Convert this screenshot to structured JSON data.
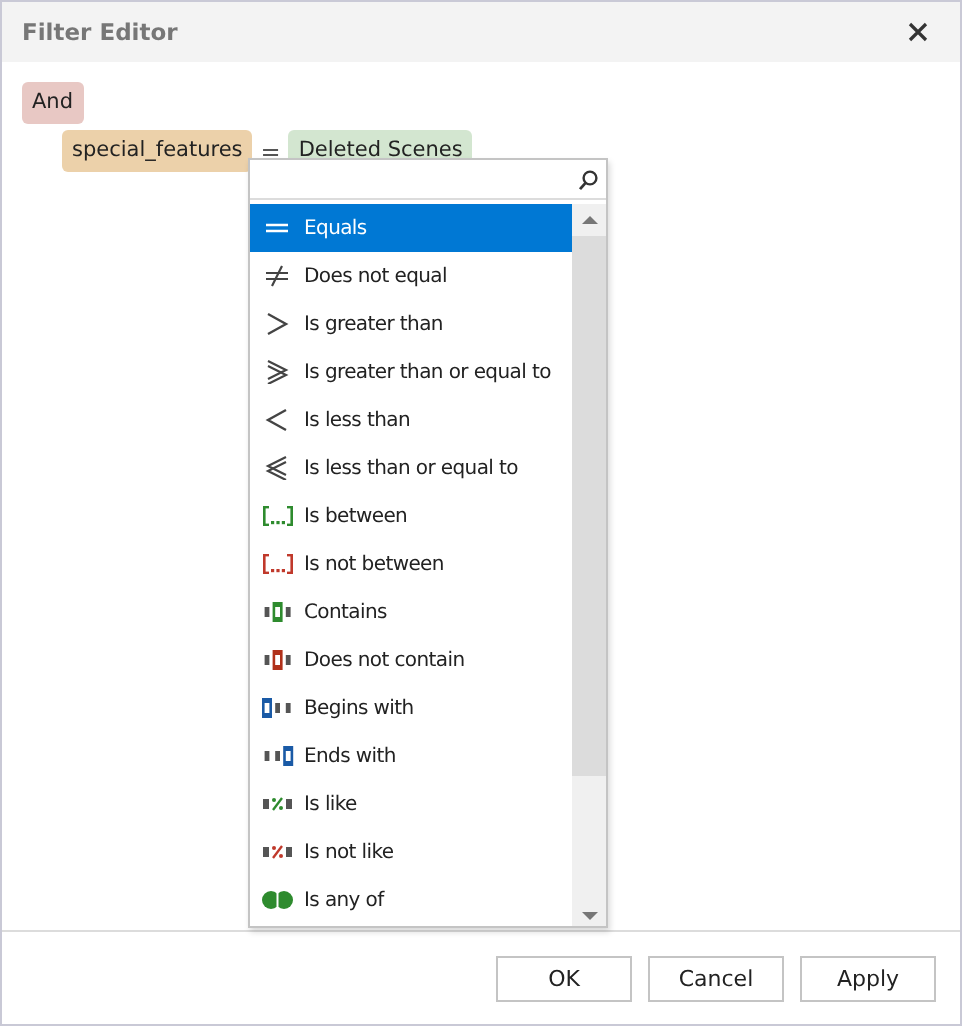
{
  "window": {
    "title": "Filter Editor"
  },
  "filter": {
    "group": "And",
    "condition": {
      "field": "special_features",
      "operator": "=",
      "value": "Deleted Scenes"
    }
  },
  "operator_menu": {
    "items": [
      {
        "label": "Equals",
        "kind": "eq",
        "selected": true
      },
      {
        "label": "Does not equal",
        "kind": "neq",
        "selected": false
      },
      {
        "label": "Is greater than",
        "kind": "gt",
        "selected": false
      },
      {
        "label": "Is greater than or equal to",
        "kind": "gte",
        "selected": false
      },
      {
        "label": "Is less than",
        "kind": "lt",
        "selected": false
      },
      {
        "label": "Is less than or equal to",
        "kind": "lte",
        "selected": false
      },
      {
        "label": "Is between",
        "kind": "between",
        "selected": false
      },
      {
        "label": "Is not between",
        "kind": "notbetween",
        "selected": false
      },
      {
        "label": "Contains",
        "kind": "contains",
        "selected": false
      },
      {
        "label": "Does not contain",
        "kind": "notcontains",
        "selected": false
      },
      {
        "label": "Begins with",
        "kind": "begins",
        "selected": false
      },
      {
        "label": "Ends with",
        "kind": "ends",
        "selected": false
      },
      {
        "label": "Is like",
        "kind": "like",
        "selected": false
      },
      {
        "label": "Is not like",
        "kind": "notlike",
        "selected": false
      },
      {
        "label": "Is any of",
        "kind": "anyof",
        "selected": false
      }
    ]
  },
  "buttons": [
    "OK",
    "Cancel",
    "Apply"
  ]
}
